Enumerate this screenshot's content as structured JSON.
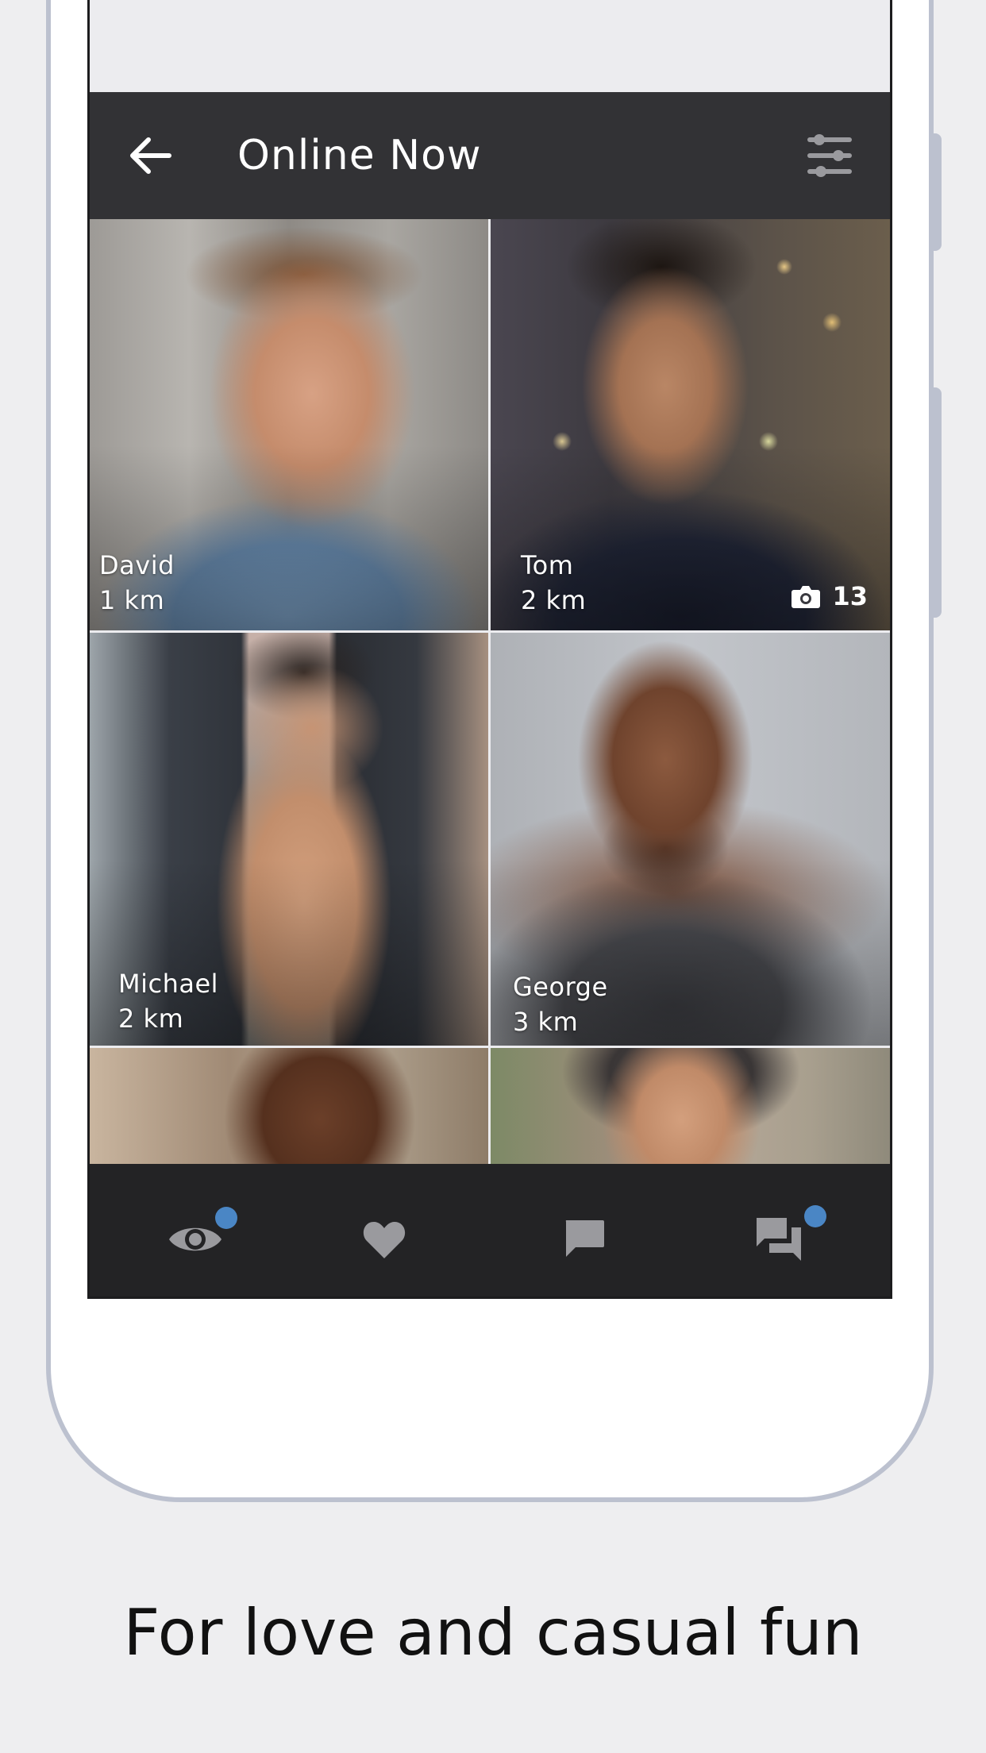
{
  "app_bar": {
    "title": "Online Now",
    "back_icon": "arrow-left-icon",
    "filter_icon": "sliders-icon"
  },
  "profiles": [
    {
      "name": "David",
      "distance": "1 km"
    },
    {
      "name": "Tom",
      "distance": "2 km",
      "photo_count": "13"
    },
    {
      "name": "Michael",
      "distance": "2 km"
    },
    {
      "name": "George",
      "distance": "3 km"
    }
  ],
  "tabs": [
    {
      "icon": "eye-icon",
      "badge": true
    },
    {
      "icon": "heart-icon",
      "badge": false
    },
    {
      "icon": "chat-bubble-icon",
      "badge": false
    },
    {
      "icon": "chats-icon",
      "badge": true
    }
  ],
  "caption": "For love and casual fun",
  "colors": {
    "app_bar": "#323235",
    "tab_bar": "#232325",
    "badge": "#4a86c5",
    "background": "#eeeef0",
    "phone_frame": "#bcc1cf"
  }
}
